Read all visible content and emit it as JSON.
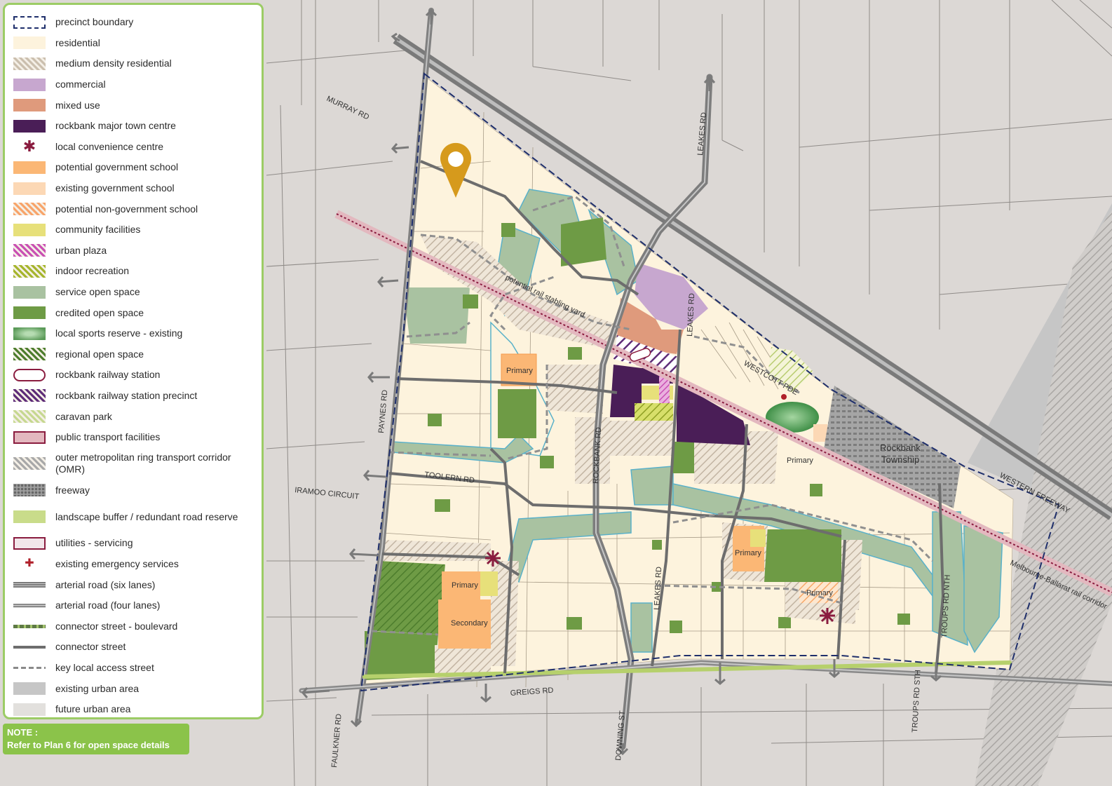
{
  "legend": {
    "items": [
      {
        "label": "precinct boundary",
        "swatch": "dashed-box",
        "color": "#1f2f6b"
      },
      {
        "label": "residential",
        "swatch": "fill",
        "color": "#fdf3dd"
      },
      {
        "label": "medium density residential",
        "swatch": "hatch",
        "color": "#cbbfae"
      },
      {
        "label": "commercial",
        "swatch": "fill",
        "color": "#c7a7cf"
      },
      {
        "label": "mixed use",
        "swatch": "fill",
        "color": "#df9a7c"
      },
      {
        "label": "rockbank major town centre",
        "swatch": "fill",
        "color": "#4a1e57"
      },
      {
        "label": "local convenience centre",
        "swatch": "star",
        "color": "#8a1c3f"
      },
      {
        "label": "potential government school",
        "swatch": "fill",
        "color": "#fbb775"
      },
      {
        "label": "existing government school",
        "swatch": "fill",
        "color": "#fcd8b5"
      },
      {
        "label": "potential non-government school",
        "swatch": "hatch",
        "color": "#f8a46a"
      },
      {
        "label": "community facilities",
        "swatch": "fill",
        "color": "#e7e07a"
      },
      {
        "label": "urban plaza",
        "swatch": "hatch",
        "color": "#c94fb3"
      },
      {
        "label": "indoor recreation",
        "swatch": "hatch",
        "color": "#a5b52c"
      },
      {
        "label": "service open space",
        "swatch": "fill",
        "color": "#a9c2a1"
      },
      {
        "label": "credited open space",
        "swatch": "fill",
        "color": "#6e9b45"
      },
      {
        "label": "local sports reserve - existing",
        "swatch": "gradient",
        "color": "#5a9a58"
      },
      {
        "label": "regional open space",
        "swatch": "hatch",
        "color": "#4d7d2d"
      },
      {
        "label": "rockbank railway station",
        "swatch": "station",
        "color": "#8a1c3f"
      },
      {
        "label": "rockbank railway station precinct",
        "swatch": "hatch",
        "color": "#5e2c78"
      },
      {
        "label": "caravan park",
        "swatch": "hatch",
        "color": "#c6d890"
      },
      {
        "label": "public transport facilities",
        "swatch": "fill-border",
        "color": "#e3b8bf"
      },
      {
        "label": "outer metropolitan ring transport corridor (OMR)",
        "swatch": "hatch",
        "color": "#a8a8a8"
      },
      {
        "label": "freeway",
        "swatch": "dots",
        "color": "#7d7d7d"
      },
      {
        "label": "landscape buffer / redundant road reserve",
        "swatch": "fill",
        "color": "#c9dc8a"
      },
      {
        "label": "utilities - servicing",
        "swatch": "fill-border",
        "color": "#f2e6ea"
      },
      {
        "label": "existing emergency services",
        "swatch": "cross",
        "color": "#b0202a"
      },
      {
        "label": "arterial road (six lanes)",
        "swatch": "road6",
        "color": "#7a7a7a"
      },
      {
        "label": "arterial road (four lanes)",
        "swatch": "road4",
        "color": "#8a8a8a"
      },
      {
        "label": "connector street - boulevard",
        "swatch": "boulevard",
        "color": "#5e7a45"
      },
      {
        "label": "connector street",
        "swatch": "line",
        "color": "#6d6d6d"
      },
      {
        "label": "key local access street",
        "swatch": "dashline",
        "color": "#8a8a8a"
      },
      {
        "label": "existing urban area",
        "swatch": "fill",
        "color": "#c6c6c6"
      },
      {
        "label": "future urban area",
        "swatch": "fill",
        "color": "#e2e0dd"
      }
    ]
  },
  "note": {
    "title": "NOTE :",
    "text": "Refer to Plan 6 for open space details"
  },
  "map": {
    "road_labels": {
      "murray": "MURRAY RD",
      "leakes_north": "LEAKES RD",
      "paynes": "PAYNES RD",
      "toolern": "TOOLERN RD",
      "iramoo": "IRAMOO CIRCUIT",
      "greigs": "GREIGS RD",
      "faulkner": "FAULKNER RD",
      "downing": "DOWNING ST",
      "rockbank": "ROCKBANK RD",
      "leakes_south": "LEAKES RD",
      "troups_north": "TROUPS RD NTH",
      "troups_south": "TROUPS RD STH",
      "western_freeway": "WESTERN FREEWAY",
      "westcott": "WESTCOTT PDE",
      "rail_stabling": "potential rail stabling yard",
      "melbourne_ballarat": "Melbourne-Ballarat rail corridor",
      "leakes_mid": "LEAKES RD"
    },
    "area_labels": {
      "township_line1": "Rockbank",
      "township_line2": "Township",
      "primary_1": "Primary",
      "primary_2": "Primary",
      "primary_3": "Primary",
      "primary_4": "Primary",
      "primary_5": "Primary",
      "secondary": "Secondary"
    },
    "marker_color": "#d69a1c"
  }
}
